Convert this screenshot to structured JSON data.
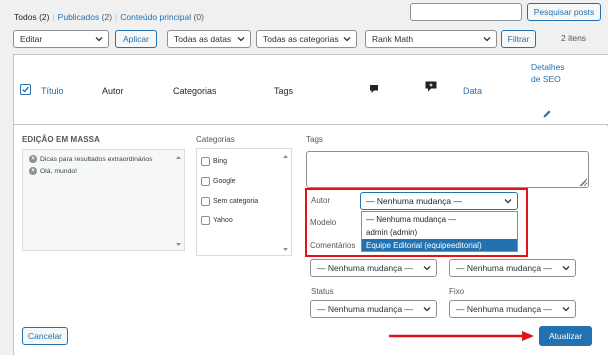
{
  "filters": {
    "all_label": "Todos",
    "all_count": "(2)",
    "separator": "|",
    "published_label": "Publicados",
    "published_count": "(2)",
    "main_content_label": "Conteúdo principal",
    "main_content_count": "(0)"
  },
  "search": {
    "placeholder": "",
    "button_label": "Pesquisar posts"
  },
  "tablenav": {
    "bulk_action": "Editar",
    "apply_label": "Aplicar",
    "dates_filter": "Todas as datas",
    "categories_filter": "Todas as categorias",
    "rankmath_filter": "Rank Math",
    "filter_label": "Filtrar",
    "items_count": "2 itens"
  },
  "table_header": {
    "title": "Título",
    "author": "Autor",
    "categories": "Categorias",
    "tags": "Tags",
    "date": "Data",
    "seo_details": "Detalhes de SEO"
  },
  "bulk_edit": {
    "heading": "EDIÇÃO EM MASSA",
    "posts": [
      "Dicas para resultados extraordinários",
      "Olá, mundo!"
    ],
    "categories_label": "Categorias",
    "categories": [
      "Bing",
      "Google",
      "Sem categoria",
      "Yahoo"
    ],
    "tags_label": "Tags",
    "author_label": "Autor",
    "author_value": "— Nenhuma mudança —",
    "author_options": [
      "— Nenhuma mudança —",
      "admin (admin)",
      "Equipe Editorial (equipeeditorial)"
    ],
    "author_selected_index": 2,
    "template_label": "Modelo",
    "comments_label": "Comentários",
    "comments_value": "— Nenhuma mudança —",
    "pings_value": "— Nenhuma mudança —",
    "status_label": "Status",
    "status_value": "— Nenhuma mudança —",
    "sticky_label": "Fixo",
    "sticky_value": "— Nenhuma mudança —",
    "cancel_label": "Cancelar",
    "update_label": "Atualizar"
  },
  "colors": {
    "accent": "#2271b1",
    "highlight": "#e0131b"
  }
}
